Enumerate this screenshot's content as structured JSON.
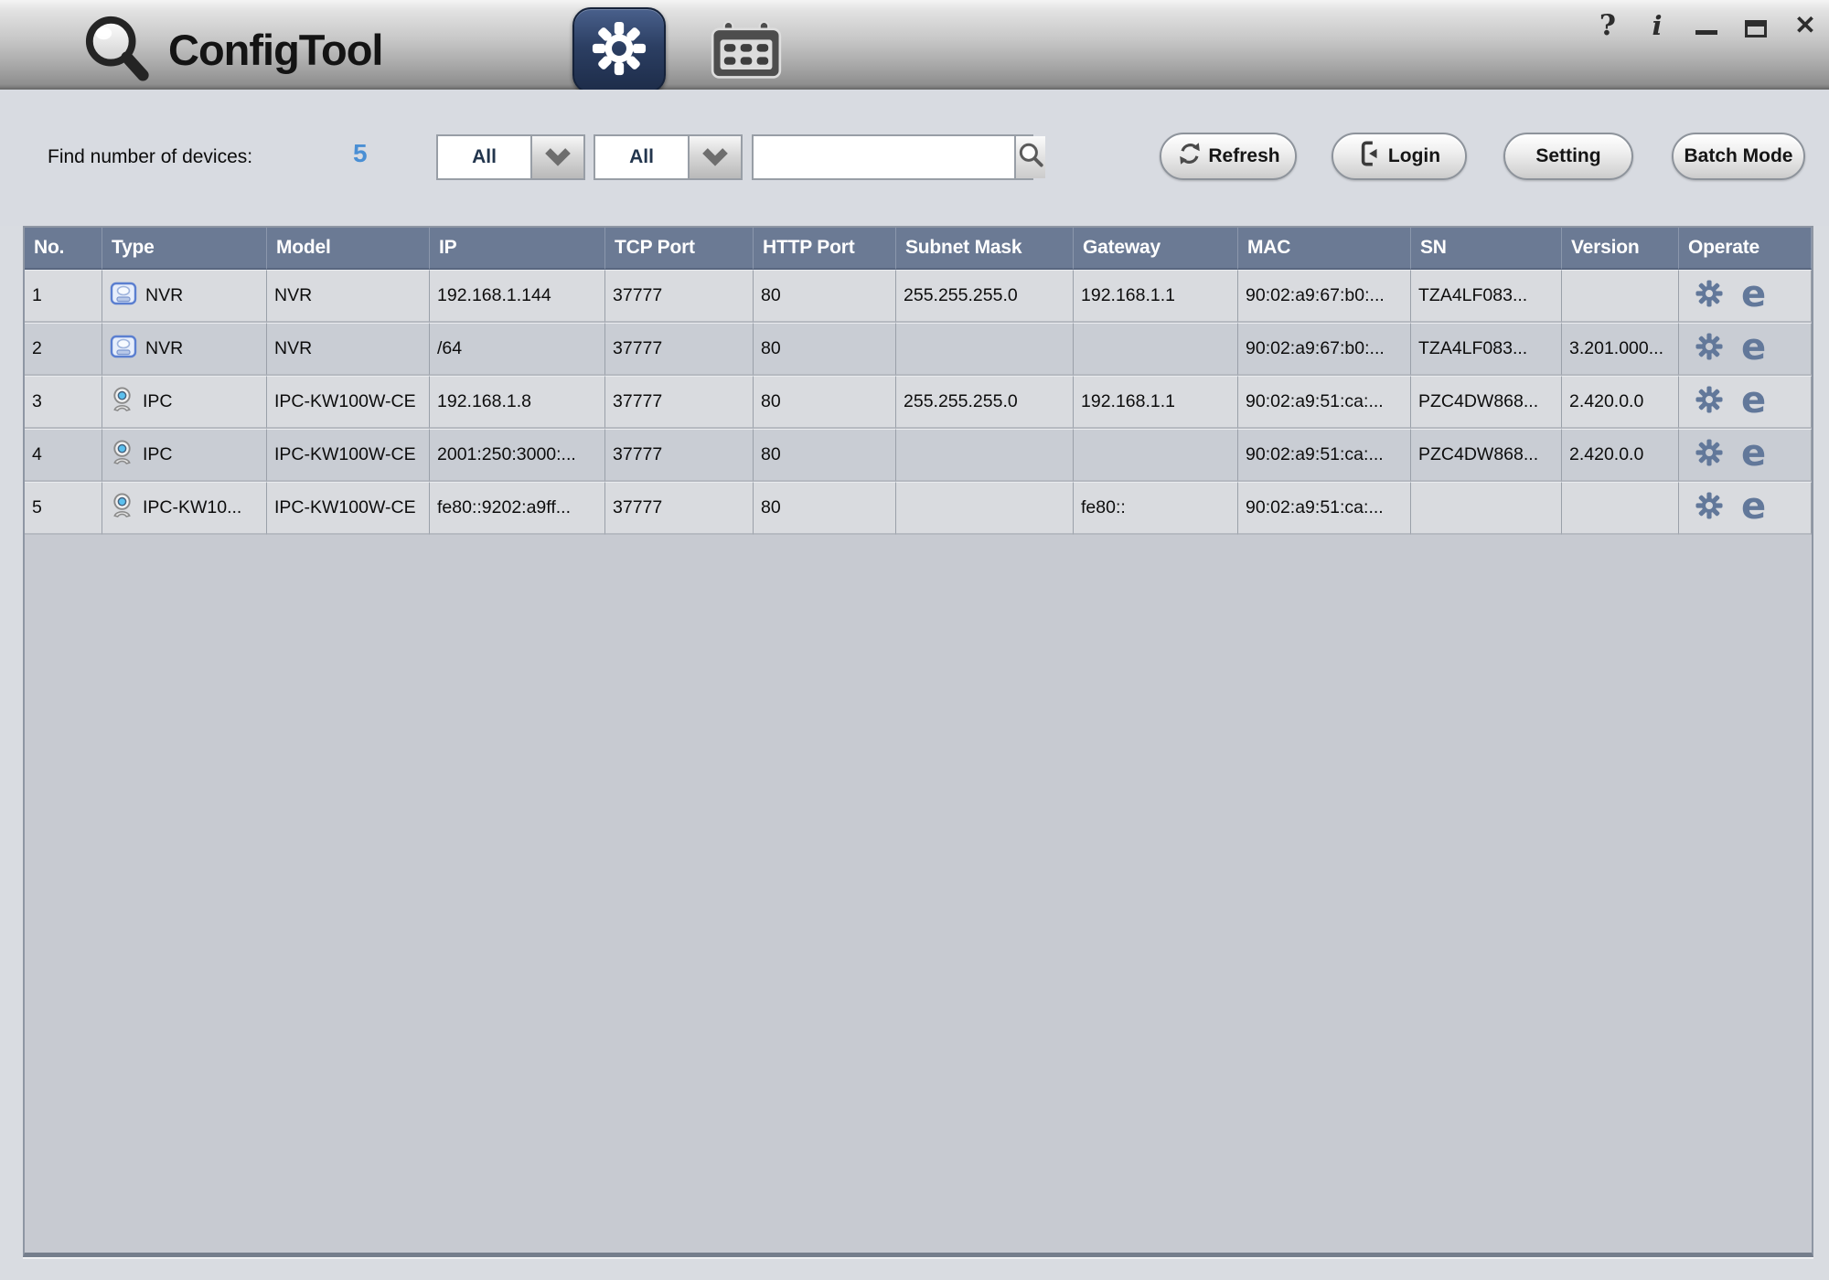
{
  "window": {
    "app_title": "ConfigTool",
    "help_glyph": "?",
    "info_glyph": "i",
    "close_glyph": "✕"
  },
  "header": {
    "logo_text": "ConfigTool",
    "tabs": [
      {
        "name": "settings",
        "icon": "gear-icon",
        "active": true
      },
      {
        "name": "calendar",
        "icon": "calendar-icon",
        "active": false
      }
    ]
  },
  "toolbar": {
    "count_label": "Find number of devices:",
    "device_count": "5",
    "filters": [
      {
        "value": "All"
      },
      {
        "value": "All"
      }
    ],
    "search_value": "",
    "buttons": [
      {
        "label": "Refresh",
        "icon": "refresh-icon"
      },
      {
        "label": "Login",
        "icon": "login-icon"
      },
      {
        "label": "Setting",
        "icon": ""
      },
      {
        "label": "Batch Mode",
        "icon": ""
      }
    ]
  },
  "table": {
    "columns": [
      "No.",
      "Type",
      "Model",
      "IP",
      "TCP Port",
      "HTTP Port",
      "Subnet Mask",
      "Gateway",
      "MAC",
      "SN",
      "Version",
      "Operate"
    ],
    "operate": {
      "icons": [
        "gear-icon",
        "ie-browser-icon"
      ],
      "ie_glyph": "e"
    },
    "rows": [
      {
        "no": "1",
        "type": "NVR",
        "type_icon": "nvr",
        "model": "NVR",
        "ip": "192.168.1.144",
        "tcp": "37777",
        "http": "80",
        "subnet": "255.255.255.0",
        "gateway": "192.168.1.1",
        "mac": "90:02:a9:67:b0:...",
        "sn": "TZA4LF083...",
        "version": ""
      },
      {
        "no": "2",
        "type": "NVR",
        "type_icon": "nvr",
        "model": "NVR",
        "ip": "/64",
        "tcp": "37777",
        "http": "80",
        "subnet": "",
        "gateway": "",
        "mac": "90:02:a9:67:b0:...",
        "sn": "TZA4LF083...",
        "version": "3.201.000..."
      },
      {
        "no": "3",
        "type": "IPC",
        "type_icon": "ipc",
        "model": "IPC-KW100W-CE",
        "ip": "192.168.1.8",
        "tcp": "37777",
        "http": "80",
        "subnet": "255.255.255.0",
        "gateway": "192.168.1.1",
        "mac": "90:02:a9:51:ca:...",
        "sn": "PZC4DW868...",
        "version": "2.420.0.0"
      },
      {
        "no": "4",
        "type": "IPC",
        "type_icon": "ipc",
        "model": "IPC-KW100W-CE",
        "ip": "2001:250:3000:...",
        "tcp": "37777",
        "http": "80",
        "subnet": "",
        "gateway": "",
        "mac": "90:02:a9:51:ca:...",
        "sn": "PZC4DW868...",
        "version": "2.420.0.0"
      },
      {
        "no": "5",
        "type": "IPC-KW10...",
        "type_icon": "ipc",
        "model": "IPC-KW100W-CE",
        "ip": "fe80::9202:a9ff...",
        "tcp": "37777",
        "http": "80",
        "subnet": "",
        "gateway": "fe80::",
        "mac": "90:02:a9:51:ca:...",
        "sn": "",
        "version": ""
      }
    ]
  },
  "colors": {
    "accent_blue": "#4a8fd4",
    "table_header_bg": "#6b7a94",
    "operate_icon": "#62789a",
    "active_tab": "#2c3f63"
  }
}
